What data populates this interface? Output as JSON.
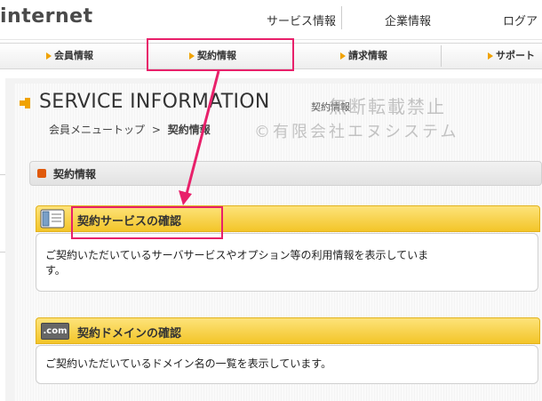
{
  "header": {
    "brand": "internet",
    "links": [
      "サービス情報",
      "企業情報",
      "ログア"
    ]
  },
  "gnav": {
    "items": [
      "会員情報",
      "契約情報",
      "請求情報",
      "サポート"
    ]
  },
  "page": {
    "title": "SERVICE INFORMATION",
    "subtitle": "契約情報",
    "breadcrumb": {
      "parent": "会員メニュートップ",
      "separator": ">",
      "current": "契約情報"
    }
  },
  "watermark": {
    "line1": "無断転載禁止",
    "line2": "©有限会社エヌシステム"
  },
  "section": {
    "title": "契約情報"
  },
  "cards": [
    {
      "icon": "book-icon",
      "title": "契約サービスの確認",
      "body_line1": "ご契約いただいているサーバサービスやオプション等の利用情報を表示していま",
      "body_line2": "す。"
    },
    {
      "icon_label": ".com",
      "title": "契約ドメインの確認",
      "body_line1": "ご契約いただいているドメイン名の一覧を表示しています。"
    }
  ],
  "colors": {
    "accent_orange": "#f0a200",
    "highlight_pink": "#e8206a",
    "card_header_yellow": "#f3c529",
    "section_icon": "#e0590a"
  }
}
